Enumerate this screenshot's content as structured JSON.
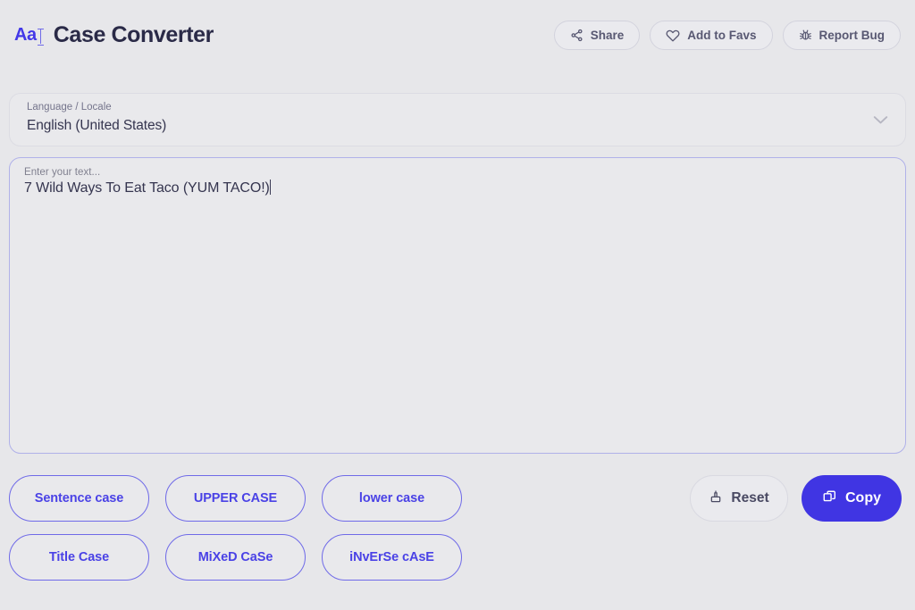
{
  "header": {
    "logo_text": "Aa",
    "logo_icon": "text-cursor-icon",
    "title": "Case Converter",
    "actions": [
      {
        "label": "Share",
        "icon": "share-icon"
      },
      {
        "label": "Add to Favs",
        "icon": "heart-icon"
      },
      {
        "label": "Report Bug",
        "icon": "bug-icon"
      }
    ]
  },
  "locale": {
    "label": "Language / Locale",
    "value": "English (United States)",
    "icon": "chevron-down-icon"
  },
  "editor": {
    "placeholder": "Enter your text...",
    "label": "Enter your text...",
    "value": "7 Wild Ways To Eat Taco (YUM TACO!)"
  },
  "case_buttons": [
    {
      "label": "Sentence case"
    },
    {
      "label": "UPPER CASE"
    },
    {
      "label": "lower case"
    },
    {
      "label": "Title Case"
    },
    {
      "label": "MiXeD CaSe"
    },
    {
      "label": "iNvErSe cAsE"
    }
  ],
  "actions": {
    "reset_label": "Reset",
    "reset_icon": "eraser-icon",
    "copy_label": "Copy",
    "copy_icon": "copy-icon"
  },
  "colors": {
    "background": "#e7e7ea",
    "panel": "#e9e9ec",
    "accent": "#4035e3",
    "accent_outline": "#6f6ae8",
    "title": "#2a2a47",
    "muted_text": "#75758c"
  }
}
